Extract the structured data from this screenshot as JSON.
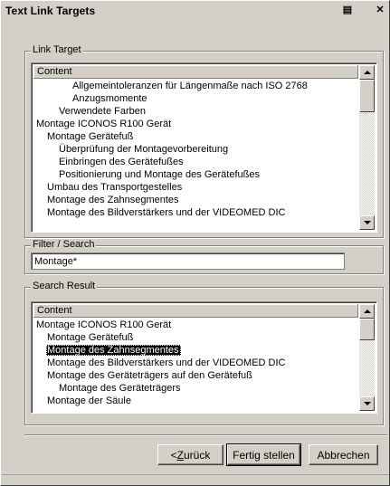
{
  "window": {
    "title": "Text Link Targets",
    "icon_button_glyph": "▤",
    "close_button_glyph": "✕"
  },
  "link_target": {
    "group_label": "Link Target",
    "column_header": "Content",
    "items": [
      {
        "label": "Allgemeintoleranzen für Längenmaße nach ISO 2768",
        "depth": 3
      },
      {
        "label": "Anzugsmomente",
        "depth": 3
      },
      {
        "label": "Verwendete Farben",
        "depth": 2
      },
      {
        "label": "Montage ICONOS R100 Gerät",
        "depth": 0
      },
      {
        "label": "Montage Gerätefuß",
        "depth": 1
      },
      {
        "label": "Überprüfung der Montagevorbereitung",
        "depth": 2
      },
      {
        "label": "Einbringen des Gerätefußes",
        "depth": 2
      },
      {
        "label": "Positionierung und Montage des Gerätefußes",
        "depth": 2
      },
      {
        "label": "Umbau des Transportgestelles",
        "depth": 1
      },
      {
        "label": "Montage des Zahnsegmentes",
        "depth": 1
      },
      {
        "label": "Montage des Bildverstärkers und der VIDEOMED DIC",
        "depth": 1
      }
    ]
  },
  "filter": {
    "group_label": "Filter / Search",
    "value": "Montage*"
  },
  "search_result": {
    "group_label": "Search Result",
    "column_header": "Content",
    "items": [
      {
        "label": "Montage ICONOS R100 Gerät",
        "depth": 0,
        "selected": false
      },
      {
        "label": "Montage Gerätefuß",
        "depth": 1,
        "selected": false
      },
      {
        "label": "Montage des Zahnsegmentes",
        "depth": 1,
        "selected": true
      },
      {
        "label": "Montage des Bildverstärkers und der VIDEOMED DIC",
        "depth": 1,
        "selected": false
      },
      {
        "label": "Montage des Geräteträgers auf den Gerätefuß",
        "depth": 1,
        "selected": false
      },
      {
        "label": "Montage des Geräteträgers",
        "depth": 2,
        "selected": false
      },
      {
        "label": "Montage der Säule",
        "depth": 1,
        "selected": false
      }
    ]
  },
  "buttons": {
    "back_prefix": "< ",
    "back_mnemonic": "Z",
    "back_rest": "urück",
    "finish": "Fertig stellen",
    "cancel": "Abbrechen"
  }
}
